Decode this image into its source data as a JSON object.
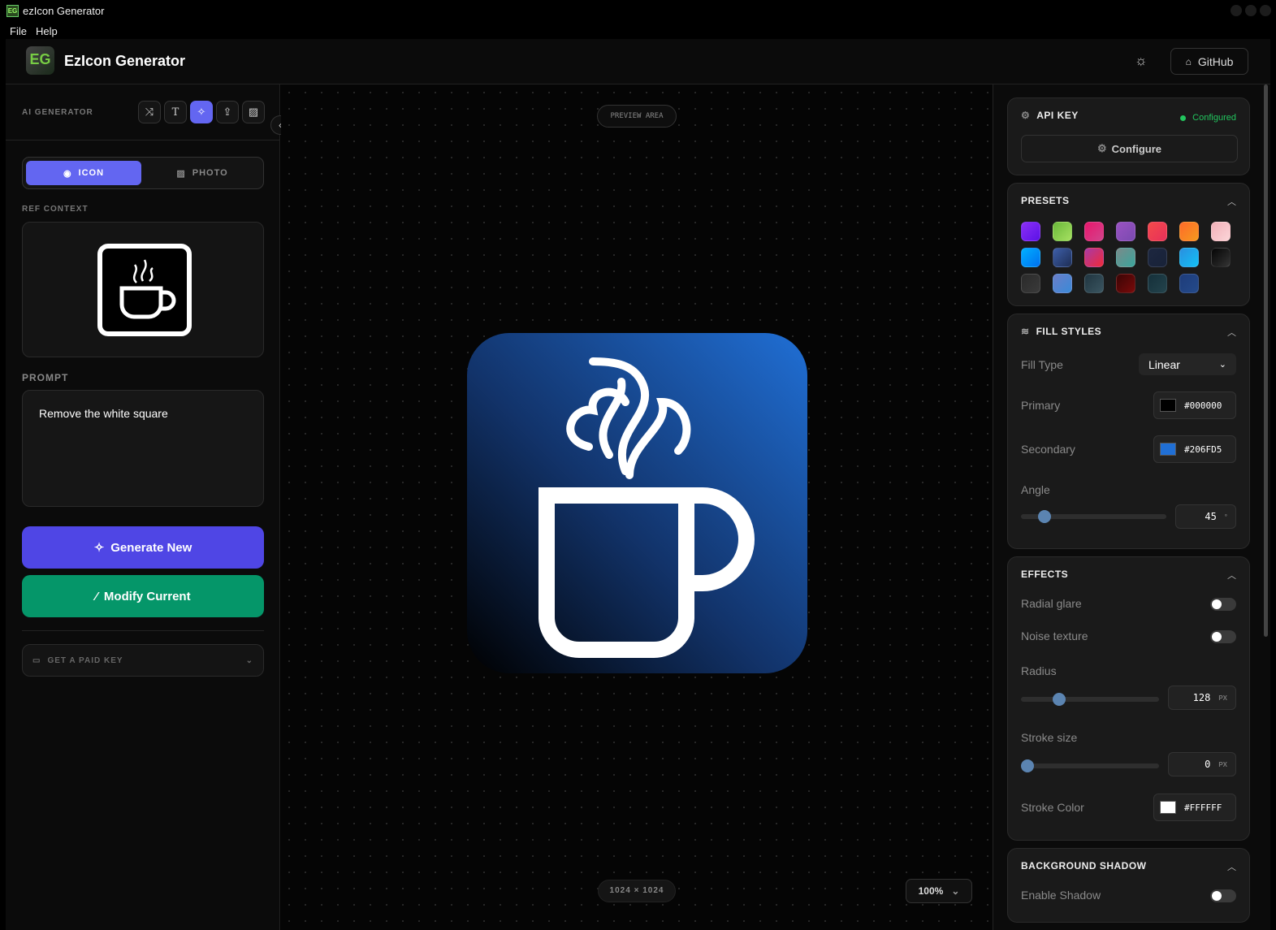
{
  "window": {
    "title": "ezIcon Generator",
    "menu": [
      "File",
      "Help"
    ]
  },
  "header": {
    "app_name": "EzIcon Generator",
    "logo_text": "EG",
    "github_label": "GitHub"
  },
  "left": {
    "section_label": "AI GENERATOR",
    "tool_icons": [
      "shuffle-icon",
      "text-icon",
      "sparkles-icon",
      "upload-icon",
      "image-icon"
    ],
    "mode_tabs": [
      {
        "label": "ICON",
        "active": true
      },
      {
        "label": "PHOTO",
        "active": false
      }
    ],
    "ref_context_label": "REF CONTEXT",
    "prompt_label": "PROMPT",
    "prompt_value": "Remove the white square",
    "generate_label": "Generate New",
    "modify_label": "Modify Current",
    "paid_key_label": "GET A PAID KEY"
  },
  "canvas": {
    "preview_label": "PREVIEW AREA",
    "size_label": "1024 × 1024",
    "zoom": "100%"
  },
  "right": {
    "api_key": {
      "title": "API KEY",
      "status": "Configured",
      "configure_label": "Configure",
      "status_color": "#22c55e"
    },
    "presets": {
      "title": "PRESETS",
      "swatches": [
        [
          "#8b2ff5",
          "#5b12e6"
        ],
        [
          "#6ab83a",
          "#a6e061"
        ],
        [
          "#e8176c",
          "#d2438c"
        ],
        [
          "#9a52c2",
          "#7a4ab0"
        ],
        [
          "#f34a4a",
          "#e8305a"
        ],
        [
          "#ff6a2a",
          "#f59a1e"
        ],
        [
          "#f2b0b8",
          "#fbd5d8"
        ],
        [
          "#00b0ff",
          "#0070f0"
        ],
        [
          "#3d5ea8",
          "#1e2e55"
        ],
        [
          "#a93aa6",
          "#f02a3a"
        ],
        [
          "#7a8a8a",
          "#3aa59c"
        ],
        [
          "#1d2740",
          "#182238"
        ],
        [
          "#2a8fe0",
          "#12c0f5"
        ],
        [
          "#050505",
          "#333333"
        ],
        [
          "#2a2a2a",
          "#3a3a3a"
        ],
        [
          "#6a7ec8",
          "#3a8ad8"
        ],
        [
          "#203540",
          "#3a5560"
        ],
        [
          "#3a0505",
          "#7a0a0a"
        ],
        [
          "#15303a",
          "#23434c"
        ],
        [
          "#1e3c7a",
          "#244a8a"
        ]
      ]
    },
    "fill_styles": {
      "title": "FILL STYLES",
      "fill_type_label": "Fill Type",
      "fill_type_value": "Linear",
      "primary_label": "Primary",
      "primary_value": "#000000",
      "secondary_label": "Secondary",
      "secondary_value": "#206FD5",
      "angle_label": "Angle",
      "angle_value": "45",
      "angle_unit": "°",
      "angle_fraction": 0.125
    },
    "effects": {
      "title": "EFFECTS",
      "radial_glare_label": "Radial glare",
      "radial_glare": false,
      "noise_label": "Noise texture",
      "noise": false,
      "radius_label": "Radius",
      "radius_value": "128",
      "radius_unit": "PX",
      "stroke_size_label": "Stroke size",
      "stroke_size_value": "0",
      "stroke_unit": "PX",
      "stroke_color_label": "Stroke Color",
      "stroke_color_value": "#FFFFFF"
    },
    "background_shadow": {
      "title": "BACKGROUND SHADOW",
      "enable_label": "Enable Shadow",
      "enabled": false
    }
  }
}
